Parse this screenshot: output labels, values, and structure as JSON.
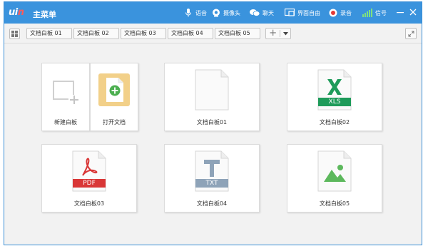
{
  "titlebar": {
    "logo_part1": "ui",
    "logo_part2": "n",
    "title": "主菜单",
    "items": [
      {
        "label": "语音",
        "icon": "microphone-icon"
      },
      {
        "label": "摄像头",
        "icon": "camera-icon"
      },
      {
        "label": "聊天",
        "icon": "chat-icon"
      },
      {
        "label": "界面自由",
        "icon": "layout-icon"
      },
      {
        "label": "录音",
        "icon": "record-icon"
      },
      {
        "label": "信号",
        "icon": "signal-icon"
      }
    ]
  },
  "tabs": [
    "文档白板 01",
    "文档白板 02",
    "文档白板 03",
    "文档白板 04",
    "文档白板 05"
  ],
  "cards": {
    "new_board": "新建白板",
    "open_doc": "打开文档",
    "docs": [
      {
        "label": "文档白板01",
        "badge": ""
      },
      {
        "label": "文档白板02",
        "badge": "XLS"
      },
      {
        "label": "文档白板03",
        "badge": "PDF"
      },
      {
        "label": "文档白板04",
        "badge": "TXT"
      },
      {
        "label": "文档白板05",
        "badge": ""
      }
    ]
  },
  "colors": {
    "titlebar": "#3a93dd",
    "xls": "#1e9b5a",
    "pdf": "#d93636",
    "txt": "#8ea3b8",
    "image": "#5cb85c",
    "open_doc": "#f2d089"
  }
}
